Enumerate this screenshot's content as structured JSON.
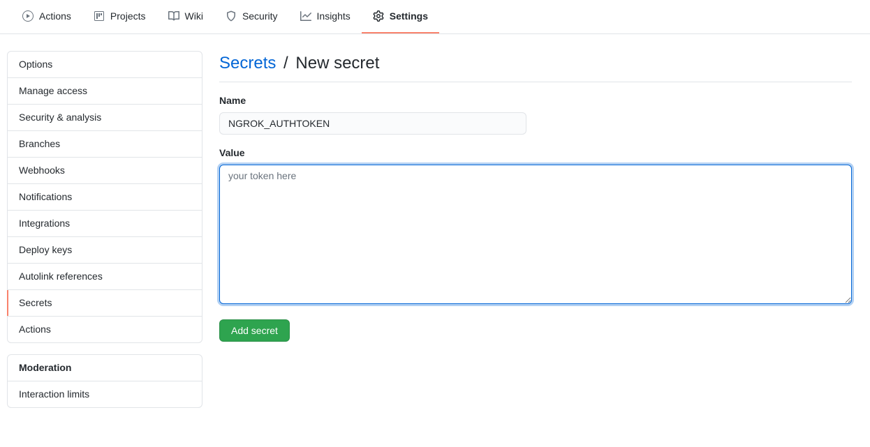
{
  "tabs": [
    {
      "label": "Actions"
    },
    {
      "label": "Projects"
    },
    {
      "label": "Wiki"
    },
    {
      "label": "Security"
    },
    {
      "label": "Insights"
    },
    {
      "label": "Settings"
    }
  ],
  "sidebar": {
    "items": [
      {
        "label": "Options"
      },
      {
        "label": "Manage access"
      },
      {
        "label": "Security & analysis"
      },
      {
        "label": "Branches"
      },
      {
        "label": "Webhooks"
      },
      {
        "label": "Notifications"
      },
      {
        "label": "Integrations"
      },
      {
        "label": "Deploy keys"
      },
      {
        "label": "Autolink references"
      },
      {
        "label": "Secrets"
      },
      {
        "label": "Actions"
      }
    ],
    "moderation_heading": "Moderation",
    "moderation_items": [
      {
        "label": "Interaction limits"
      }
    ]
  },
  "subhead": {
    "secrets_link": "Secrets",
    "separator": "/",
    "page": "New secret"
  },
  "form": {
    "name_label": "Name",
    "name_value": "NGROK_AUTHTOKEN",
    "value_label": "Value",
    "value_placeholder": "your token here",
    "submit_label": "Add secret"
  }
}
